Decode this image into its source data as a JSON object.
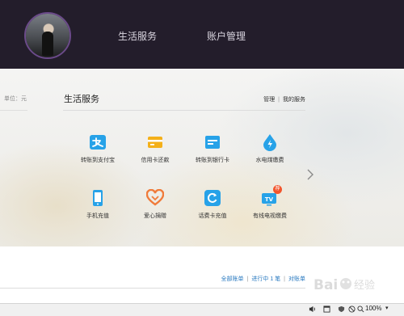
{
  "header": {
    "nav": [
      "生活服务",
      "账户管理"
    ]
  },
  "left_panel": {
    "unit_label": "单位：元"
  },
  "services_panel": {
    "title": "生活服务",
    "links": [
      "管理",
      "我的服务"
    ],
    "items": [
      {
        "label": "转账到支付宝",
        "icon": "alipay-transfer-icon",
        "color": "#27a2e8"
      },
      {
        "label": "信用卡还款",
        "icon": "credit-card-icon",
        "color": "#f4b019"
      },
      {
        "label": "转账到银行卡",
        "icon": "bank-card-icon",
        "color": "#27a2e8"
      },
      {
        "label": "水电煤缴费",
        "icon": "water-drop-icon",
        "color": "#27a2e8"
      },
      {
        "label": "手机充值",
        "icon": "mobile-phone-icon",
        "color": "#27a2e8"
      },
      {
        "label": "爱心捐赠",
        "icon": "heart-icon",
        "color": "#f07b3a"
      },
      {
        "label": "话费卡充值",
        "icon": "refresh-card-icon",
        "color": "#27a2e8"
      },
      {
        "label": "有线电视缴费",
        "icon": "tv-icon",
        "color": "#27a2e8",
        "badge": "荐"
      }
    ]
  },
  "bills": {
    "links": [
      "全部账单",
      "进行中 1 笔",
      "对账单"
    ]
  },
  "statusbar": {
    "zoom": "100%"
  },
  "watermark": {
    "text": "Baidu 经验"
  }
}
